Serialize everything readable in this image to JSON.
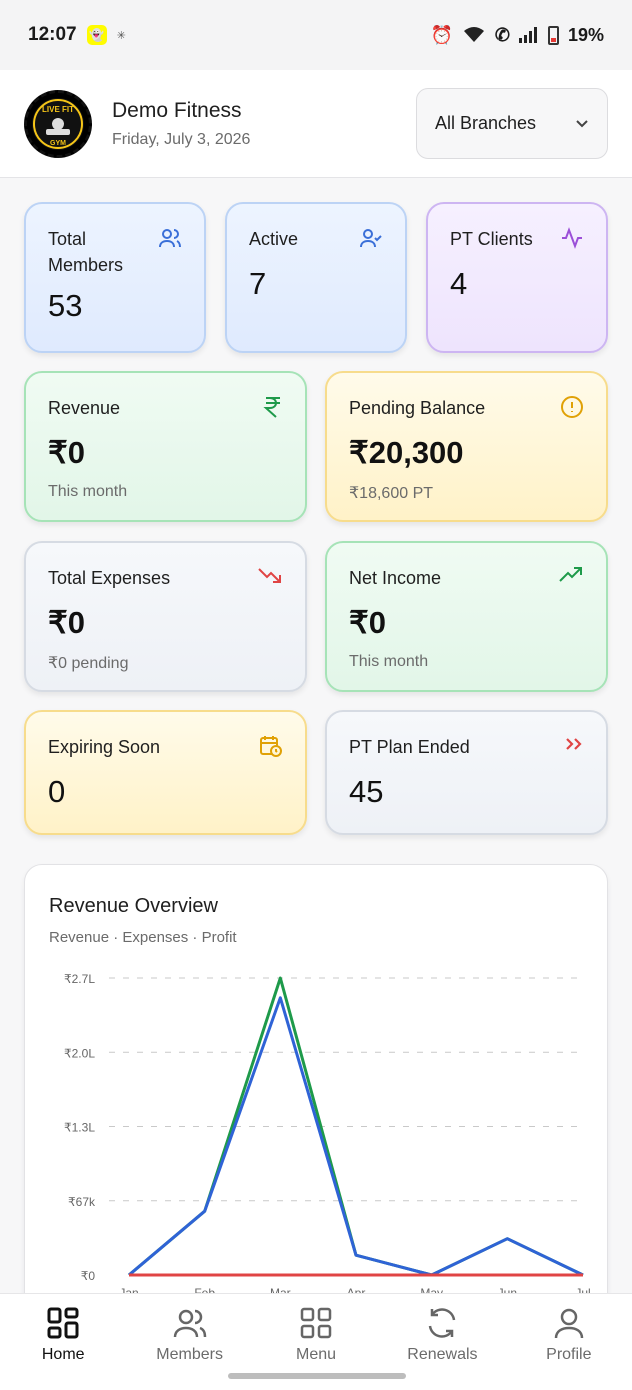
{
  "status_bar": {
    "time": "12:07",
    "battery": "19%"
  },
  "header": {
    "logo_text": "LIVE FIT GYM",
    "gym_name": "Demo Fitness",
    "date": "Friday, July 3, 2026",
    "branch_selector": "All Branches"
  },
  "stats": {
    "total_members": {
      "title": "Total Members",
      "value": "53",
      "icon": "users-icon"
    },
    "active": {
      "title": "Active",
      "value": "7",
      "icon": "user-check-icon"
    },
    "pt_clients": {
      "title": "PT Clients",
      "value": "4",
      "icon": "activity-icon"
    },
    "revenue": {
      "title": "Revenue",
      "value": "₹0",
      "sub": "This month",
      "icon": "rupee-icon"
    },
    "pending_balance": {
      "title": "Pending Balance",
      "value": "₹20,300",
      "sub": "₹18,600 PT",
      "icon": "alert-circle-icon"
    },
    "total_expenses": {
      "title": "Total Expenses",
      "value": "₹0",
      "sub": "₹0 pending",
      "icon": "trending-down-icon"
    },
    "net_income": {
      "title": "Net Income",
      "value": "₹0",
      "sub": "This month",
      "icon": "trending-up-icon"
    },
    "expiring_soon": {
      "title": "Expiring Soon",
      "value": "0",
      "icon": "calendar-clock-icon"
    },
    "pt_plan_ended": {
      "title": "PT Plan Ended",
      "value": "45",
      "icon": "chevrons-right-icon"
    }
  },
  "chart_data": {
    "type": "line",
    "title": "Revenue Overview",
    "subtitle": "Revenue · Expenses · Profit",
    "y_ticks": [
      "₹2.7L",
      "₹2.0L",
      "₹1.3L",
      "₹67k",
      "₹0"
    ],
    "x_ticks": [
      "Jan",
      "Feb",
      "Mar",
      "Apr",
      "May",
      "Jun",
      "Jul"
    ],
    "ylim": [
      0,
      270000
    ],
    "grid": true,
    "x": [
      "Jan",
      "Feb",
      "Mar",
      "Apr",
      "May",
      "Jun",
      "Jul"
    ],
    "series": [
      {
        "name": "Revenue",
        "color": "#1e9a4a",
        "values": [
          0,
          58000,
          270000,
          18000,
          0,
          33000,
          0
        ]
      },
      {
        "name": "Profit",
        "color": "#2f63d6",
        "values": [
          0,
          58000,
          252000,
          18000,
          0,
          33000,
          0
        ]
      },
      {
        "name": "Expenses",
        "color": "#e04444",
        "values": [
          0,
          0,
          0,
          0,
          0,
          0,
          0
        ]
      }
    ]
  },
  "nav": {
    "items": [
      {
        "label": "Home",
        "icon": "home-grid-icon"
      },
      {
        "label": "Members",
        "icon": "users-icon"
      },
      {
        "label": "Menu",
        "icon": "menu-grid-icon"
      },
      {
        "label": "Renewals",
        "icon": "refresh-icon"
      },
      {
        "label": "Profile",
        "icon": "user-icon"
      }
    ]
  }
}
